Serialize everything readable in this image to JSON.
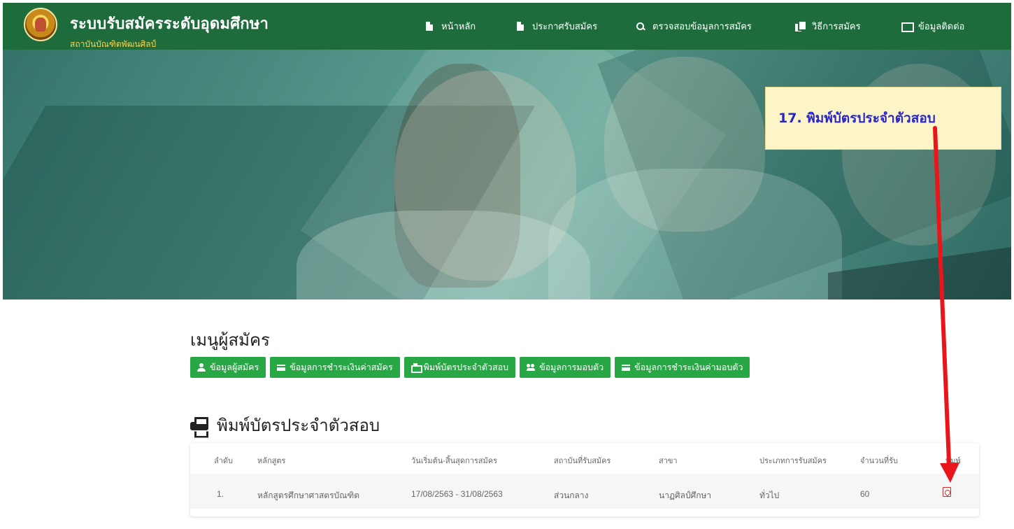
{
  "header": {
    "brand_title": "ระบบรับสมัครระดับอุดมศึกษา",
    "brand_subtitle": "สถาบันบัณฑิตพัฒนศิลป์",
    "nav": [
      {
        "label": "หน้าหลัก",
        "icon": "document-icon"
      },
      {
        "label": "ประกาศรับสมัคร",
        "icon": "document-icon"
      },
      {
        "label": "ตรวจสอบข้อมูลการสมัคร",
        "icon": "search-icon"
      },
      {
        "label": "วิธีการสมัคร",
        "icon": "copy-icon"
      },
      {
        "label": "ข้อมูลติดต่อ",
        "icon": "monitor-icon"
      }
    ]
  },
  "callout": {
    "text": "17. พิมพ์บัตรประจำตัวสอบ"
  },
  "menu": {
    "title": "เมนูผู้สมัคร",
    "buttons": [
      {
        "label": "ข้อมูลผู้สมัคร",
        "icon": "user-icon"
      },
      {
        "label": "ข้อมูลการชำระเงินค่าสมัคร",
        "icon": "card-icon"
      },
      {
        "label": "พิมพ์บัตรประจำตัวสอบ",
        "icon": "print-icon"
      },
      {
        "label": "ข้อมูลการมอบตัว",
        "icon": "users-icon"
      },
      {
        "label": "ข้อมูลการชำระเงินค่ามอบตัว",
        "icon": "card-icon"
      }
    ]
  },
  "section": {
    "title": "พิมพ์บัตรประจำตัวสอบ"
  },
  "table": {
    "headers": [
      "ลำดับ",
      "หลักสูตร",
      "วันเริ่มต้น-สิ้นสุดการสมัคร",
      "สถาบันที่รับสมัคร",
      "สาขา",
      "ประเภทการรับสมัคร",
      "จำนวนที่รับ",
      "พิมพ์"
    ],
    "rows": [
      [
        "1.",
        "หลักสูตรศึกษาศาสตรบัณฑิต",
        "17/08/2563 - 31/08/2563",
        "ส่วนกลาง",
        "นาฏศิลป์ศึกษา",
        "ทั่วไป",
        "60"
      ]
    ]
  },
  "colors": {
    "header_green": "#1e6b3c",
    "button_green": "#28a745",
    "brand_subtitle": "#ffd44d",
    "callout_bg": "#fdf4c8",
    "callout_text": "#2a27c7",
    "arrow": "#e8161b"
  }
}
